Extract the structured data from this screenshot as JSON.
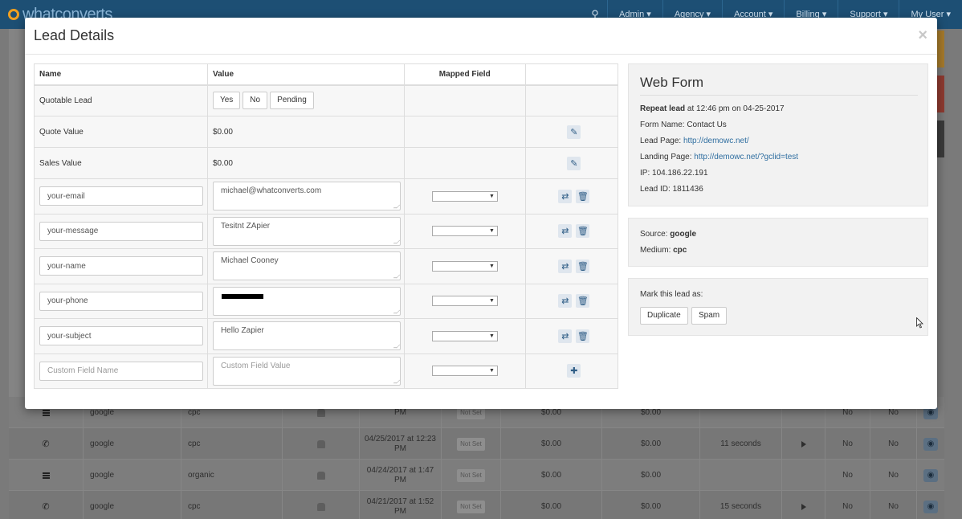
{
  "app": {
    "logo_text": "whatconverts",
    "nav": [
      "Admin ▾",
      "Agency ▾",
      "Account ▾",
      "Billing ▾",
      "Support ▾",
      "My User ▾"
    ]
  },
  "background_rows": [
    {
      "type": "form",
      "source": "google",
      "medium": "cpc",
      "datetime": "PM",
      "status": "Not Set",
      "quote": "$0.00",
      "sales": "$0.00",
      "duration": "",
      "played": false,
      "dup": "No",
      "spam": "No"
    },
    {
      "type": "call",
      "source": "google",
      "medium": "cpc",
      "datetime": "04/25/2017 at 12:23 PM",
      "status": "Not Set",
      "quote": "$0.00",
      "sales": "$0.00",
      "duration": "11 seconds",
      "played": true,
      "dup": "No",
      "spam": "No"
    },
    {
      "type": "form",
      "source": "google",
      "medium": "organic",
      "datetime": "04/24/2017 at 1:47 PM",
      "status": "Not Set",
      "quote": "$0.00",
      "sales": "$0.00",
      "duration": "",
      "played": false,
      "dup": "No",
      "spam": "No"
    },
    {
      "type": "call",
      "source": "google",
      "medium": "cpc",
      "datetime": "04/21/2017 at 1:52 PM",
      "status": "Not Set",
      "quote": "$0.00",
      "sales": "$0.00",
      "duration": "15 seconds",
      "played": true,
      "dup": "No",
      "spam": "No"
    }
  ],
  "modal": {
    "title": "Lead Details",
    "close_symbol": "×",
    "table": {
      "headers": {
        "name": "Name",
        "value": "Value",
        "mapped": "Mapped Field",
        "actions": ""
      },
      "quotable": {
        "label": "Quotable Lead",
        "options": [
          "Yes",
          "No",
          "Pending"
        ]
      },
      "quote_value": {
        "label": "Quote Value",
        "value": "$0.00"
      },
      "sales_value": {
        "label": "Sales Value",
        "value": "$0.00"
      },
      "fields": [
        {
          "name": "your-email",
          "value": "michael@whatconverts.com",
          "redacted": false
        },
        {
          "name": "your-message",
          "value": "Tesitnt ZApier",
          "redacted": false
        },
        {
          "name": "your-name",
          "value": "Michael Cooney",
          "redacted": false
        },
        {
          "name": "your-phone",
          "value": "",
          "redacted": true
        },
        {
          "name": "your-subject",
          "value": "Hello Zapier",
          "redacted": false
        }
      ],
      "custom": {
        "name_placeholder": "Custom Field Name",
        "value_placeholder": "Custom Field Value"
      }
    },
    "web_form": {
      "title": "Web Form",
      "repeat_label": "Repeat lead",
      "repeat_time": " at 12:46 pm on 04-25-2017",
      "form_name": "Form Name: Contact Us",
      "lead_page_label": "Lead Page: ",
      "lead_page_url": "http://demowc.net/",
      "landing_page_label": "Landing Page: ",
      "landing_page_url": "http://demowc.net/?gclid=test",
      "ip": "IP: 104.186.22.191",
      "lead_id": "Lead ID: 1811436"
    },
    "source_panel": {
      "source_label": "Source: ",
      "source_value": "google",
      "medium_label": "Medium: ",
      "medium_value": "cpc"
    },
    "mark_panel": {
      "label": "Mark this lead as:",
      "buttons": [
        "Duplicate",
        "Spam"
      ]
    }
  },
  "colors": {
    "topbar": "#1d4f74",
    "link": "#2f6ea0",
    "icon_blue": "#2f5d86"
  }
}
